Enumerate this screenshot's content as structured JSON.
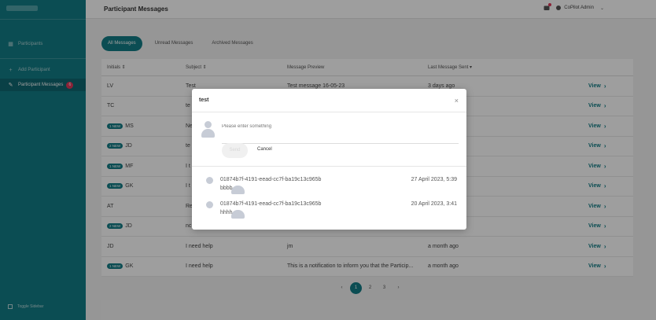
{
  "page": {
    "title": "Participant Messages"
  },
  "header": {
    "user_name": "CoPilot Admin"
  },
  "sidebar": {
    "items": [
      {
        "label": "Participants"
      },
      {
        "label": "Add Participant"
      },
      {
        "label": "Participant Messages",
        "badge": "6"
      }
    ],
    "toggle_label": "Toggle Sidebar"
  },
  "tabs": [
    {
      "label": "All Messages",
      "active": true
    },
    {
      "label": "Unread Messages"
    },
    {
      "label": "Archived Messages"
    }
  ],
  "table": {
    "columns": [
      "Initials",
      "Subject",
      "Message Preview",
      "Last Message Sent"
    ],
    "action_label": "View",
    "rows": [
      {
        "badge": "",
        "initials": "LV",
        "subject": "Test",
        "preview": "Test message 16-05-23",
        "sent": "3 days ago"
      },
      {
        "badge": "",
        "initials": "TC",
        "subject": "te",
        "preview": "",
        "sent": ""
      },
      {
        "badge": "1 NEW",
        "initials": "MS",
        "subject": "Ne",
        "preview": "",
        "sent": ""
      },
      {
        "badge": "2 NEW",
        "initials": "JD",
        "subject": "te",
        "preview": "",
        "sent": ""
      },
      {
        "badge": "1 NEW",
        "initials": "MF",
        "subject": "I t",
        "preview": "",
        "sent": ""
      },
      {
        "badge": "1 NEW",
        "initials": "GK",
        "subject": "I t",
        "preview": "",
        "sent": ""
      },
      {
        "badge": "",
        "initials": "AT",
        "subject": "Re",
        "preview": "",
        "sent": ""
      },
      {
        "badge": "2 NEW",
        "initials": "JD",
        "subject": "nc",
        "preview": "",
        "sent": ""
      },
      {
        "badge": "",
        "initials": "JD",
        "subject": "I need help",
        "preview": "jm",
        "sent": "a month ago"
      },
      {
        "badge": "1 NEW",
        "initials": "GK",
        "subject": "I need help",
        "preview": "This is a notification to inform you that the Particip...",
        "sent": "a month ago"
      }
    ]
  },
  "pagination": {
    "prev": "‹",
    "pages": [
      "1",
      "2",
      "3"
    ],
    "current": "1",
    "next": "›"
  },
  "modal": {
    "title": "test",
    "close_symbol": "×",
    "placeholder": "Please enter something",
    "send_label": "Send",
    "cancel_label": "Cancel",
    "messages": [
      {
        "sender": "01874b7f-4191-eead-cc7f-ba19c13c965b",
        "body": "bbbb",
        "date": "27 April 2023, 5:39"
      },
      {
        "sender": "01874b7f-4191-eead-cc7f-ba19c13c965b",
        "body": "hhhh",
        "date": "20 April 2023, 3:41"
      }
    ]
  }
}
